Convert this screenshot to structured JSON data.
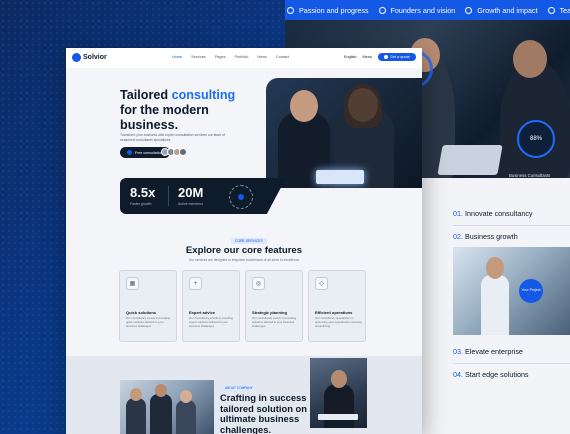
{
  "back_panel": {
    "topbar_items": [
      "Passion and progress",
      "Founders and vision",
      "Growth and impact",
      "Team and values"
    ],
    "photo_circle_value": "88%",
    "photo_caption": "Business Consultants",
    "list": [
      {
        "num": "01.",
        "label": "Innovate consultancy"
      },
      {
        "num": "02.",
        "label": "Business growth"
      },
      {
        "num": "03.",
        "label": "Elevate enterprise"
      },
      {
        "num": "04.",
        "label": "Start edge solutions"
      }
    ],
    "list_photo_circle": "Your Project"
  },
  "main": {
    "logo": "Solvior",
    "nav_links": [
      "Home",
      "Services",
      "Pages",
      "Portfolio",
      "News",
      "Contact"
    ],
    "nav_language": "English",
    "nav_menu": "Menu",
    "nav_button": "Get a quote",
    "hero": {
      "title_line1_plain": "Tailored ",
      "title_line1_accent": "consulting",
      "title_line2": "for the modern",
      "title_line3": "business.",
      "subtitle": "Transform your business with expert consultation services our team of seasoned consultants specializes",
      "cta": "Free consultation"
    },
    "stats": [
      {
        "value": "8.5x",
        "label": "Faster growth"
      },
      {
        "value": "20M",
        "label": "Active members"
      }
    ],
    "features": {
      "badge": "CORE SERVICES",
      "title": "Explore our core features",
      "subtitle": "Our services are designed to empower businesses of all sizes to excellence",
      "cards": [
        {
          "icon": "grid-icon",
          "glyph": "▦",
          "title": "Quick solutions",
          "desc": "Our consultancy excels in providing quick solutions tailored to your business challenges"
        },
        {
          "icon": "plus-icon",
          "glyph": "+",
          "title": "Expert advice",
          "desc": "Our consultancy excels in providing expert solutions tailored to your business challenges"
        },
        {
          "icon": "target-icon",
          "glyph": "◎",
          "title": "Strategic planning",
          "desc": "Our consultancy excels in providing solutions tailored to your business challenges"
        },
        {
          "icon": "diamond-icon",
          "glyph": "◇",
          "title": "Efficient operations",
          "desc": "Our consultancy specializes in optimizing your operational processes streamlining"
        }
      ]
    },
    "bottom": {
      "badge": "ABOUT COMPANY",
      "title": "Crafting in success tailored solution on ultimate business challenges."
    }
  }
}
